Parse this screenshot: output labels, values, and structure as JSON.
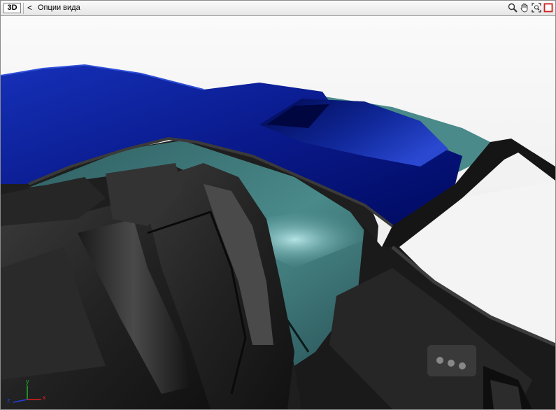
{
  "toolbar": {
    "view_button_label": "3D",
    "back_label": "<",
    "title": "Опции вида",
    "tools": [
      {
        "icon": "zoom-icon"
      },
      {
        "icon": "pan-hand-icon"
      },
      {
        "icon": "zoom-extents-icon"
      },
      {
        "icon": "maximize-icon"
      }
    ]
  },
  "axes": {
    "x_label": "x",
    "y_label": "y",
    "z_label": "z",
    "colors": {
      "x": "#e02020",
      "y": "#20b020",
      "z": "#2040e0"
    }
  },
  "colors": {
    "roof_blue": "#0a1a8c",
    "glass_teal": "#4a8a8a",
    "interior_dark": "#1e1e1e",
    "background": "#f4f4f4"
  }
}
